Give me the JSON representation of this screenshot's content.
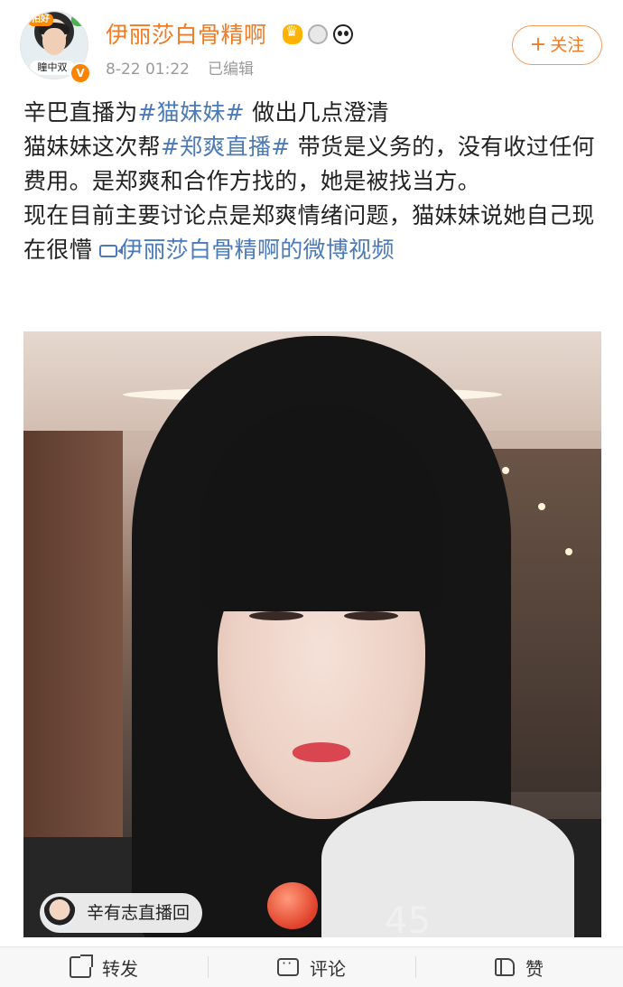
{
  "header": {
    "avatar_tag": "拍好",
    "avatar_caption": "瞳中双",
    "verified_mark": "V",
    "username": "伊丽莎白骨精啊",
    "timestamp": "8-22 01:22",
    "edited_label": "已编辑",
    "follow_plus": "+",
    "follow_label": "关注"
  },
  "post": {
    "line1_prefix": "辛巴直播为",
    "line1_hashtag": "#猫妹妹#",
    "line1_suffix": " 做出几点澄清",
    "line2_prefix": "猫妹妹这次帮",
    "line2_hashtag": "#郑爽直播#",
    "line2_suffix": " 带货是义务的，没有收过任何费用。是郑爽和合作方找的，她是被找当方。",
    "line3": "现在目前主要讨论点是郑爽情绪问题，猫妹妹说她自己现在很懵 ",
    "video_link": "伊丽莎白骨精啊的微博视频"
  },
  "video": {
    "live_tag": "辛有志直播回",
    "time_watermark": "45"
  },
  "actions": {
    "repost": "转发",
    "comment": "评论",
    "like": "赞"
  },
  "colors": {
    "username": "#f07b26",
    "link": "#4a7ab8",
    "meta": "#9a9a9a"
  }
}
